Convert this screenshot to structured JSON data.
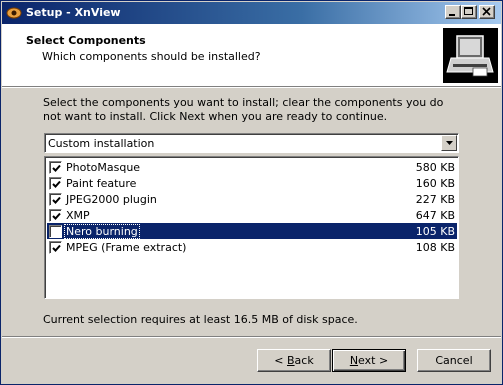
{
  "window": {
    "title": "Setup - XnView",
    "icons": [
      "xnview-app-icon",
      "minimize-icon",
      "maximize-icon",
      "close-icon"
    ]
  },
  "header": {
    "title": "Select Components",
    "subtitle": "Which components should be installed?",
    "image": "setup-computer-icon"
  },
  "instructions": "Select the components you want to install; clear the components you do not want to install. Click Next when you are ready to continue.",
  "install_type": {
    "selected": "Custom installation"
  },
  "components": [
    {
      "name": "PhotoMasque",
      "size": "580 KB",
      "checked": true,
      "selected": false
    },
    {
      "name": "Paint feature",
      "size": "160 KB",
      "checked": true,
      "selected": false
    },
    {
      "name": "JPEG2000 plugin",
      "size": "227 KB",
      "checked": true,
      "selected": false
    },
    {
      "name": "XMP",
      "size": "647 KB",
      "checked": true,
      "selected": false
    },
    {
      "name": "Nero burning",
      "size": "105 KB",
      "checked": false,
      "selected": true
    },
    {
      "name": "MPEG (Frame extract)",
      "size": "108 KB",
      "checked": true,
      "selected": false
    }
  ],
  "disk_space": "Current selection requires at least 16.5 MB of disk space.",
  "buttons": {
    "back_prefix": "< ",
    "back_mnemonic": "B",
    "back_rest": "ack",
    "next_mnemonic": "N",
    "next_rest": "ext >",
    "cancel": "Cancel"
  },
  "colors": {
    "selection": "#0a246a",
    "face": "#d4d0c8"
  }
}
